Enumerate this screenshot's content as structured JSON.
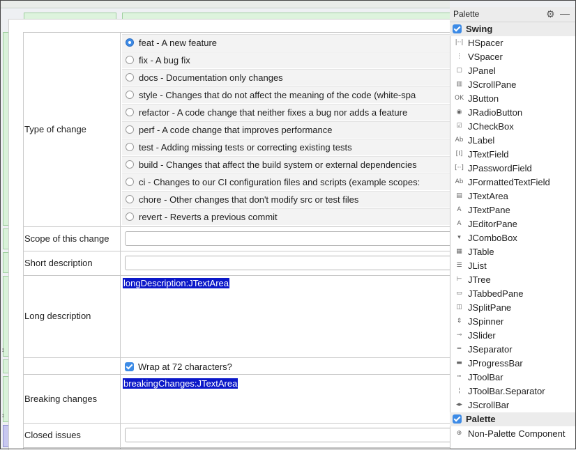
{
  "form": {
    "labels": {
      "type_of_change": "Type of change",
      "scope": "Scope of this change",
      "short_description": "Short description",
      "long_description": "Long description",
      "breaking_changes": "Breaking changes",
      "closed_issues": "Closed issues"
    },
    "radios": [
      {
        "label": "feat - A new feature",
        "checked": true
      },
      {
        "label": "fix - A bug fix",
        "checked": false
      },
      {
        "label": "docs - Documentation only changes",
        "checked": false
      },
      {
        "label": "style - Changes that do not affect the meaning of the code (white-spa",
        "checked": false
      },
      {
        "label": "refactor - A code change that neither fixes a bug nor adds a feature",
        "checked": false
      },
      {
        "label": "perf - A code change that improves performance",
        "checked": false
      },
      {
        "label": "test - Adding missing tests or correcting existing tests",
        "checked": false
      },
      {
        "label": "build - Changes that affect the build system or external dependencies",
        "checked": false
      },
      {
        "label": "ci - Changes to our CI configuration files and scripts (example scopes:",
        "checked": false
      },
      {
        "label": "chore - Other changes that don't modify src or test files",
        "checked": false
      },
      {
        "label": "revert - Reverts a previous commit",
        "checked": false
      }
    ],
    "long_description_component": "longDescription:JTextArea",
    "breaking_changes_component": "breakingChanges:JTextArea",
    "wrap_checkbox_label": "Wrap at 72 characters?",
    "wrap_checked": true
  },
  "palette": {
    "title": "Palette",
    "gear_icon": "⚙",
    "minimize_icon": "—",
    "groups": {
      "swing": "Swing",
      "palette": "Palette"
    },
    "items": [
      {
        "label": "HSpacer",
        "icon": "hspacer-icon",
        "glyph": "|··|"
      },
      {
        "label": "VSpacer",
        "icon": "vspacer-icon",
        "glyph": "⋮"
      },
      {
        "label": "JPanel",
        "icon": "panel-icon",
        "glyph": "▢"
      },
      {
        "label": "JScrollPane",
        "icon": "scrollpane-icon",
        "glyph": "▥"
      },
      {
        "label": "JButton",
        "icon": "button-icon",
        "glyph": "OK"
      },
      {
        "label": "JRadioButton",
        "icon": "radiobutton-icon",
        "glyph": "◉"
      },
      {
        "label": "JCheckBox",
        "icon": "checkbox-icon",
        "glyph": "☑"
      },
      {
        "label": "JLabel",
        "icon": "label-icon",
        "glyph": "Ab"
      },
      {
        "label": "JTextField",
        "icon": "textfield-icon",
        "glyph": "[I]"
      },
      {
        "label": "JPasswordField",
        "icon": "passwordfield-icon",
        "glyph": "[··]"
      },
      {
        "label": "JFormattedTextField",
        "icon": "formattedtextfield-icon",
        "glyph": "Ab"
      },
      {
        "label": "JTextArea",
        "icon": "textarea-icon",
        "glyph": "▤"
      },
      {
        "label": "JTextPane",
        "icon": "textpane-icon",
        "glyph": "A"
      },
      {
        "label": "JEditorPane",
        "icon": "editorpane-icon",
        "glyph": "A"
      },
      {
        "label": "JComboBox",
        "icon": "combobox-icon",
        "glyph": "▾"
      },
      {
        "label": "JTable",
        "icon": "table-icon",
        "glyph": "▦"
      },
      {
        "label": "JList",
        "icon": "list-icon",
        "glyph": "☰"
      },
      {
        "label": "JTree",
        "icon": "tree-icon",
        "glyph": "⊢"
      },
      {
        "label": "JTabbedPane",
        "icon": "tabbedpane-icon",
        "glyph": "▭"
      },
      {
        "label": "JSplitPane",
        "icon": "splitpane-icon",
        "glyph": "◫"
      },
      {
        "label": "JSpinner",
        "icon": "spinner-icon",
        "glyph": "⇕"
      },
      {
        "label": "JSlider",
        "icon": "slider-icon",
        "glyph": "⊸"
      },
      {
        "label": "JSeparator",
        "icon": "separator-icon",
        "glyph": "═"
      },
      {
        "label": "JProgressBar",
        "icon": "progressbar-icon",
        "glyph": "▬"
      },
      {
        "label": "JToolBar",
        "icon": "toolbar-icon",
        "glyph": "┅"
      },
      {
        "label": "JToolBar.Separator",
        "icon": "toolbar-separator-icon",
        "glyph": "¦"
      },
      {
        "label": "JScrollBar",
        "icon": "scrollbar-icon",
        "glyph": "◂▸"
      }
    ],
    "extra_items": [
      {
        "label": "Non-Palette Component",
        "icon": "non-palette-component-icon",
        "glyph": "⊕"
      }
    ]
  },
  "colors": {
    "selection": "#0b18c9",
    "accent": "#3d8be6",
    "layout_green": "#d9f2d9"
  }
}
